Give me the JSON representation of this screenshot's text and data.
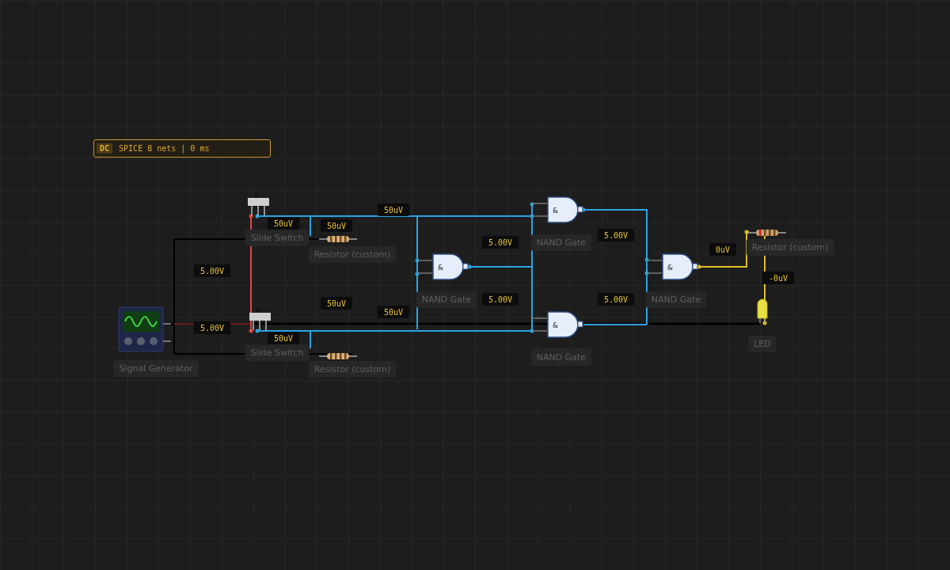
{
  "status": {
    "mode": "DC",
    "text": "SPICE 8 nets | 0 ms"
  },
  "components": [
    {
      "kind": "signal-generator",
      "label": "Signal Generator"
    },
    {
      "kind": "slide-switch",
      "label": "Slide Switch"
    },
    {
      "kind": "slide-switch",
      "label": "Slide Switch"
    },
    {
      "kind": "resistor",
      "label": "Resistor (custom)"
    },
    {
      "kind": "resistor",
      "label": "Resistor (custom)"
    },
    {
      "kind": "nand-gate",
      "label": "NAND Gate",
      "symbol": "&"
    },
    {
      "kind": "nand-gate",
      "label": "NAND Gate",
      "symbol": "&"
    },
    {
      "kind": "nand-gate",
      "label": "NAND Gate",
      "symbol": "&"
    },
    {
      "kind": "nand-gate",
      "label": "NAND Gate",
      "symbol": "&"
    },
    {
      "kind": "resistor",
      "label": "Resistor (custom)"
    },
    {
      "kind": "led",
      "label": "LED"
    }
  ],
  "voltages": [
    "50uV",
    "50uV",
    "5.00V",
    "50uV",
    "5.00V",
    "50uV",
    "50uV",
    "5.00V",
    "5.00V",
    "5.00V",
    "5.00V",
    "0uV",
    "-0uV",
    "50uV"
  ]
}
